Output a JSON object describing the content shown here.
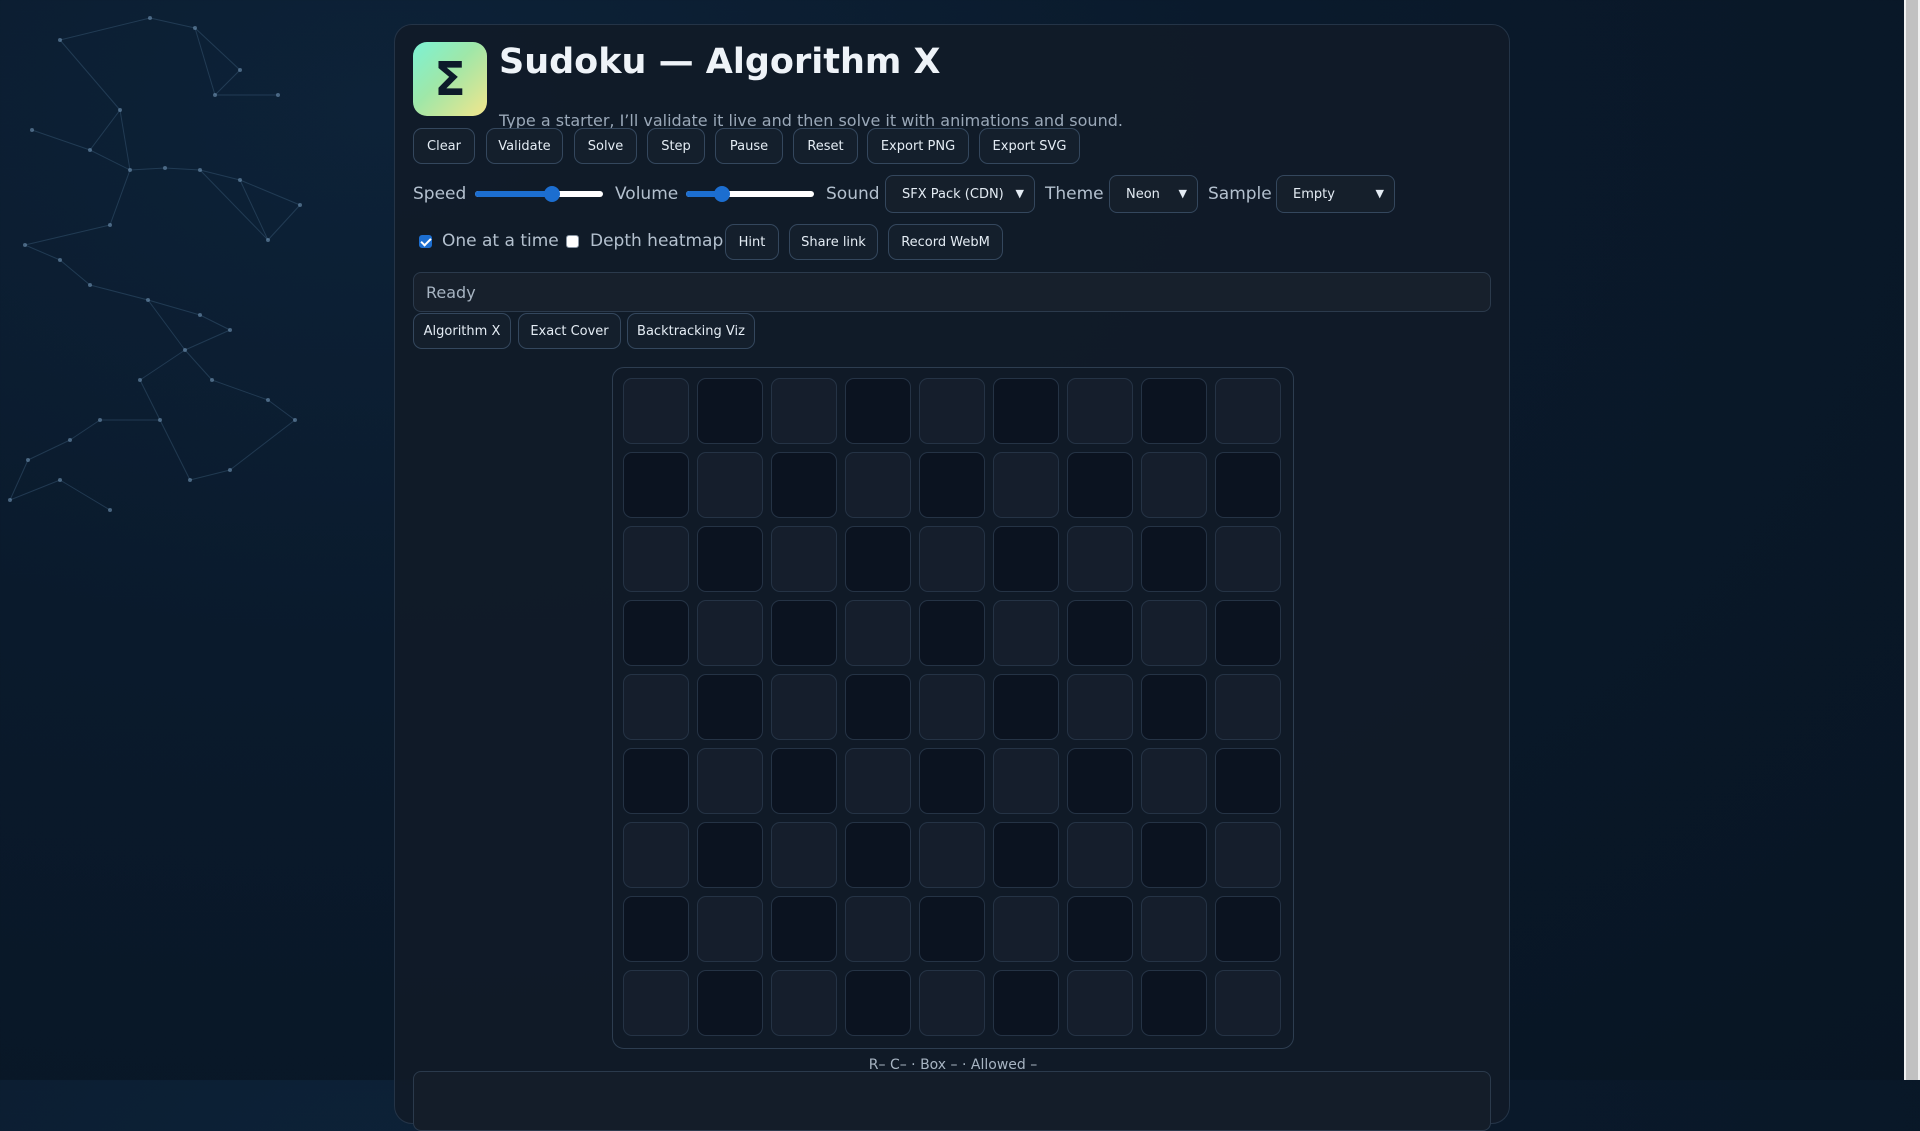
{
  "app": {
    "logo_symbol": "Σ",
    "title": "Sudoku — Algorithm X",
    "subtitle": "Type a starter, I’ll validate it live and then solve it with animations and sound."
  },
  "toolbar": {
    "buttons": [
      {
        "id": "clear",
        "label": "Clear"
      },
      {
        "id": "validate",
        "label": "Validate"
      },
      {
        "id": "solve",
        "label": "Solve"
      },
      {
        "id": "step",
        "label": "Step"
      },
      {
        "id": "pause",
        "label": "Pause"
      },
      {
        "id": "reset",
        "label": "Reset"
      },
      {
        "id": "export-png",
        "label": "Export PNG"
      },
      {
        "id": "export-svg",
        "label": "Export SVG"
      }
    ]
  },
  "controls": {
    "speed": {
      "label": "Speed",
      "value_fraction": 0.6
    },
    "volume": {
      "label": "Volume",
      "value_fraction": 0.28
    },
    "sound": {
      "label": "Sound",
      "selected": "SFX Pack (CDN)"
    },
    "theme": {
      "label": "Theme",
      "selected": "Neon"
    },
    "sample": {
      "label": "Sample",
      "selected": "Empty"
    }
  },
  "options": {
    "one_at_a_time": {
      "label": "One at a time",
      "checked": true
    },
    "depth_heatmap": {
      "label": "Depth heatmap",
      "checked": false
    },
    "hint_label": "Hint",
    "share_label": "Share link",
    "record_label": "Record WebM"
  },
  "status": {
    "text": "Ready"
  },
  "tabs": [
    {
      "id": "algorithm-x",
      "label": "Algorithm X"
    },
    {
      "id": "exact-cover",
      "label": "Exact Cover"
    },
    {
      "id": "backtracking-viz",
      "label": "Backtracking Viz"
    }
  ],
  "board": {
    "size": 9,
    "cells": [
      [
        "",
        "",
        "",
        "",
        "",
        "",
        "",
        "",
        ""
      ],
      [
        "",
        "",
        "",
        "",
        "",
        "",
        "",
        "",
        ""
      ],
      [
        "",
        "",
        "",
        "",
        "",
        "",
        "",
        "",
        ""
      ],
      [
        "",
        "",
        "",
        "",
        "",
        "",
        "",
        "",
        ""
      ],
      [
        "",
        "",
        "",
        "",
        "",
        "",
        "",
        "",
        ""
      ],
      [
        "",
        "",
        "",
        "",
        "",
        "",
        "",
        "",
        ""
      ],
      [
        "",
        "",
        "",
        "",
        "",
        "",
        "",
        "",
        ""
      ],
      [
        "",
        "",
        "",
        "",
        "",
        "",
        "",
        "",
        ""
      ],
      [
        "",
        "",
        "",
        "",
        "",
        "",
        "",
        "",
        ""
      ]
    ]
  },
  "cell_info": {
    "text": "R– C– · Box – · Allowed –"
  },
  "colors": {
    "accent": "#1c6ed0",
    "background": "#0a1a2c",
    "cell_light": "#151e2c",
    "cell_dark": "#0b1320"
  }
}
